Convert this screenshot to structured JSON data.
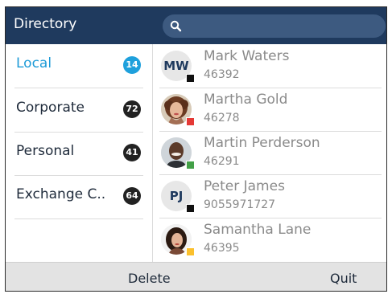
{
  "header": {
    "title": "Directory",
    "search_placeholder": ""
  },
  "sidebar": {
    "items": [
      {
        "label": "Local",
        "count": "14",
        "active": true
      },
      {
        "label": "Corporate",
        "count": "72",
        "active": false
      },
      {
        "label": "Personal",
        "count": "41",
        "active": false
      },
      {
        "label": "Exchange C..",
        "count": "64",
        "active": false
      }
    ]
  },
  "contacts": [
    {
      "name": "Mark Waters",
      "number": "46392",
      "avatar": "initials",
      "initials": "MW",
      "presence_color": "#111111"
    },
    {
      "name": "Martha Gold",
      "number": "46278",
      "avatar": "photo-woman-curly",
      "presence_color": "#e53935"
    },
    {
      "name": "Martin Perderson",
      "number": "46291",
      "avatar": "photo-man",
      "presence_color": "#43a047"
    },
    {
      "name": "Peter James",
      "number": "9055971727",
      "avatar": "initials",
      "initials": "PJ",
      "presence_color": "#111111"
    },
    {
      "name": "Samantha Lane",
      "number": "46395",
      "avatar": "photo-woman-dark-hair",
      "presence_color": "#fbc02d"
    }
  ],
  "softkeys": {
    "delete_label": "Delete",
    "quit_label": "Quit"
  },
  "colors": {
    "header_bg": "#1f3a5e",
    "accent": "#1e9bd7"
  }
}
